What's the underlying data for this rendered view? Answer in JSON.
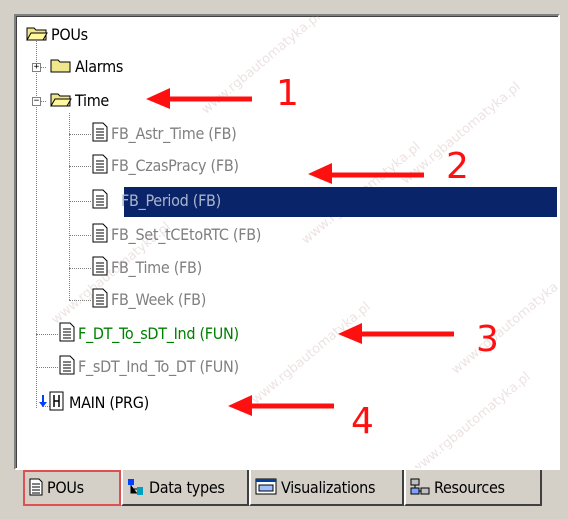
{
  "tree": {
    "root": {
      "label": "POUs",
      "icon": "open-folder-icon"
    },
    "folders": [
      {
        "label": "Alarms",
        "expander": "+",
        "icon": "folder-icon"
      },
      {
        "label": "Time",
        "expander": "−",
        "icon": "open-folder-icon"
      }
    ],
    "time_children": [
      {
        "label": "FB_Astr_Time (FB)",
        "style": "grey"
      },
      {
        "label": "FB_CzasPracy (FB)",
        "style": "grey"
      },
      {
        "label": "FB_Period (FB)",
        "style": "selected"
      },
      {
        "label": "FB_Set_tCEtoRTC (FB)",
        "style": "grey"
      },
      {
        "label": "FB_Time (FB)",
        "style": "grey"
      },
      {
        "label": "FB_Week (FB)",
        "style": "grey"
      }
    ],
    "root_children": [
      {
        "label": "F_DT_To_sDT_Ind (FUN)",
        "style": "green",
        "icon": "document-icon"
      },
      {
        "label": "F_sDT_Ind_To_DT (FUN)",
        "style": "grey",
        "icon": "document-icon"
      },
      {
        "label": "MAIN (PRG)",
        "style": "black",
        "icon": "program-icon"
      }
    ]
  },
  "annotations": [
    "1",
    "2",
    "3",
    "4"
  ],
  "watermark": "www.rgbautomatyka.pl",
  "tabs": [
    {
      "label": "POUs",
      "icon": "document-icon",
      "active": true
    },
    {
      "label": "Data types",
      "icon": "data-types-icon",
      "active": false
    },
    {
      "label": "Visualizations",
      "icon": "visualization-icon",
      "active": false
    },
    {
      "label": "Resources",
      "icon": "resources-icon",
      "active": false
    }
  ],
  "colors": {
    "selection": "#0a246a",
    "annotation": "#ff1010",
    "green_text": "#008000",
    "grey_text": "#808080",
    "panel_bg": "#d4d0c8"
  }
}
